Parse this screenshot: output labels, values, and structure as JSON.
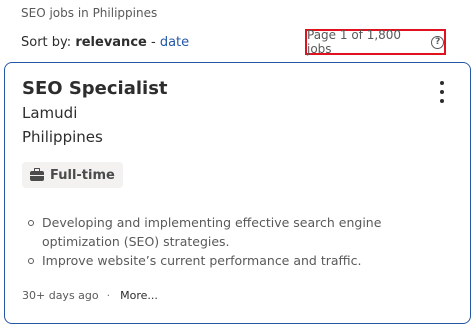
{
  "breadcrumb": "SEO jobs in Philippines",
  "sort": {
    "prefix": "Sort by:",
    "active": "relevance",
    "separator": "-",
    "alternate": "date"
  },
  "page_count": "Page 1 of 1,800 jobs",
  "job": {
    "title": "SEO Specialist",
    "company": "Lamudi",
    "location": "Philippines",
    "type": "Full-time",
    "snippet": [
      "Developing and implementing effective search engine optimization (SEO) strategies.",
      "Improve website’s current performance and traffic."
    ],
    "posted": "30+ days ago",
    "meta_separator": "·",
    "more_label": "More..."
  },
  "colors": {
    "accent": "#2557a7",
    "highlight_box": "#e0121f"
  }
}
